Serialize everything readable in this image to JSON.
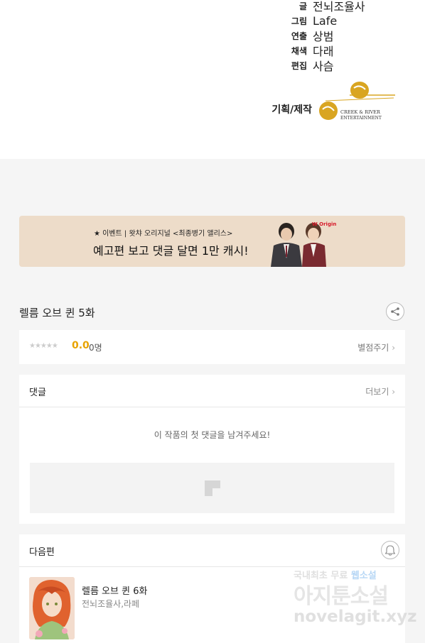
{
  "credits": [
    {
      "role": "글",
      "name": "전뇌조율사"
    },
    {
      "role": "그림",
      "name": "Lafe"
    },
    {
      "role": "연출",
      "name": "상범"
    },
    {
      "role": "채색",
      "name": "다래"
    },
    {
      "role": "편집",
      "name": "사슴"
    }
  ],
  "production": {
    "role": "기획/제작",
    "logo_text_line1": "CREEK & RIVER",
    "logo_text_line2": "ENTERTAINMENT",
    "logo_color": "#d9a521"
  },
  "banner": {
    "small_text": "★ 이벤트 | 왓챠 오리지널 <최종병기 앨리스>",
    "big_text": "예고편 보고 댓글 달면 1만 캐시!",
    "brand": "W Original",
    "background": "#eddcc9"
  },
  "episode": {
    "title": "렐름 오브 퀸 5화",
    "share_icon": "share-icon"
  },
  "rating": {
    "stars_text": "★★★★★",
    "score": "0.0",
    "voters": "0명",
    "rate_label": "별점주기",
    "score_color": "#e8a300"
  },
  "comments": {
    "header": "댓글",
    "more_label": "더보기",
    "empty_message": "이 작품의 첫 댓글을 남겨주세요!"
  },
  "next": {
    "header": "다음편",
    "bell_icon": "bell-icon",
    "title": "렐름 오브 퀸 6화",
    "authors": "전뇌조율사,라페"
  },
  "watermark": {
    "line1_prefix": "국내최초 무료",
    "line1_highlight": "웹소설",
    "line2": "아지툰소설",
    "line3": "novelagit.xyz"
  }
}
